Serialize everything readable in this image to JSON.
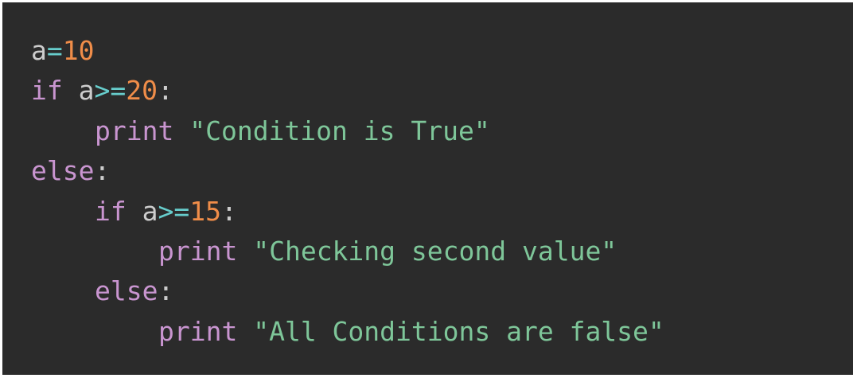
{
  "colors": {
    "background": "#2b2b2b",
    "default": "#cccccc",
    "keyword": "#c995d0",
    "number": "#f08d49",
    "string": "#7ec699",
    "operator": "#67cdcc"
  },
  "code": {
    "lines": [
      {
        "indent": 0,
        "tokens": [
          {
            "text": "a",
            "kind": "default"
          },
          {
            "text": "=",
            "kind": "operator"
          },
          {
            "text": "10",
            "kind": "number"
          }
        ]
      },
      {
        "indent": 0,
        "tokens": [
          {
            "text": "if",
            "kind": "keyword"
          },
          {
            "text": " a",
            "kind": "default"
          },
          {
            "text": ">=",
            "kind": "operator"
          },
          {
            "text": "20",
            "kind": "number"
          },
          {
            "text": ":",
            "kind": "default"
          }
        ]
      },
      {
        "indent": 1,
        "tokens": [
          {
            "text": "print",
            "kind": "keyword"
          },
          {
            "text": " ",
            "kind": "default"
          },
          {
            "text": "\"Condition is True\"",
            "kind": "string"
          }
        ]
      },
      {
        "indent": 0,
        "tokens": [
          {
            "text": "else",
            "kind": "keyword"
          },
          {
            "text": ":",
            "kind": "default"
          }
        ]
      },
      {
        "indent": 1,
        "tokens": [
          {
            "text": "if",
            "kind": "keyword"
          },
          {
            "text": " a",
            "kind": "default"
          },
          {
            "text": ">=",
            "kind": "operator"
          },
          {
            "text": "15",
            "kind": "number"
          },
          {
            "text": ":",
            "kind": "default"
          }
        ]
      },
      {
        "indent": 2,
        "tokens": [
          {
            "text": "print",
            "kind": "keyword"
          },
          {
            "text": " ",
            "kind": "default"
          },
          {
            "text": "\"Checking second value\"",
            "kind": "string"
          }
        ]
      },
      {
        "indent": 1,
        "tokens": [
          {
            "text": "else",
            "kind": "keyword"
          },
          {
            "text": ":",
            "kind": "default"
          }
        ]
      },
      {
        "indent": 2,
        "tokens": [
          {
            "text": "print",
            "kind": "keyword"
          },
          {
            "text": " ",
            "kind": "default"
          },
          {
            "text": "\"All Conditions are false\"",
            "kind": "string"
          }
        ]
      }
    ]
  }
}
